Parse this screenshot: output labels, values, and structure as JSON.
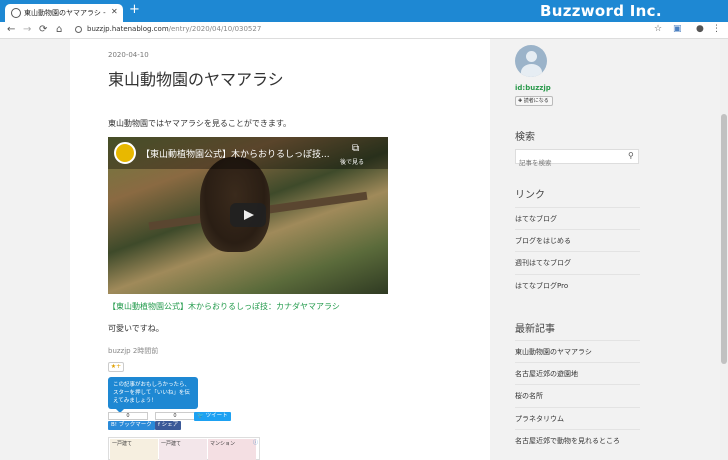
{
  "browser": {
    "tab_title": "東山動物園のヤマアラシ - パズのお手",
    "close_glyph": "✕",
    "new_tab_glyph": "+",
    "brand": "Buzzword Inc.",
    "url_domain": "buzzjp.hatenablog.com",
    "url_path": "/entry/2020/04/10/030527",
    "nav": {
      "back": "←",
      "forward": "→",
      "reload": "⟳",
      "home": "⌂"
    },
    "icons": {
      "star": "☆",
      "ext": "▣",
      "profile": "●",
      "menu": "⋮"
    }
  },
  "article": {
    "date": "2020-04-10",
    "title": "東山動物園のヤマアラシ",
    "intro": "東山動物園ではヤマアラシを見ることができます。",
    "video_title": "【東山動植物園公式】木からおりるしっぽ技...",
    "video_later": "後で見る",
    "video_link": "【東山動植物園公式】木からおりるしっぽ技：カナダヤマアラシ",
    "comment": "可愛いですね。",
    "author_meta": "buzzjp 2時間前",
    "star_add": "★+",
    "tooltip": "この記事がおもしろかったら、スターを押して「いいね」を伝えてみましょう！",
    "counts": {
      "hatena": "0",
      "facebook": "0"
    },
    "buttons": {
      "hatena": "B! ブックマーク",
      "share": "f シェア",
      "tweet": "ツイート"
    },
    "ad": {
      "cells": [
        "一戸建て",
        "一戸建て",
        "マンション"
      ],
      "info": "ⓘ"
    }
  },
  "sidebar": {
    "user_id": "id:buzzjp",
    "reader_button": "✚ 読者になる",
    "search_heading": "検索",
    "search_placeholder": "記事を検索",
    "links_heading": "リンク",
    "links": [
      "はてなブログ",
      "ブログをはじめる",
      "週刊はてなブログ",
      "はてなブログPro"
    ],
    "recent_heading": "最新記事",
    "recent": [
      "東山動物園のヤマアラシ",
      "名古屋近郊の遊園地",
      "桜の名所",
      "プラネタリウム",
      "名古屋近郊で動物を見れるところ"
    ]
  },
  "colors": {
    "accent": "#1e88d3",
    "link": "#239b4c"
  }
}
